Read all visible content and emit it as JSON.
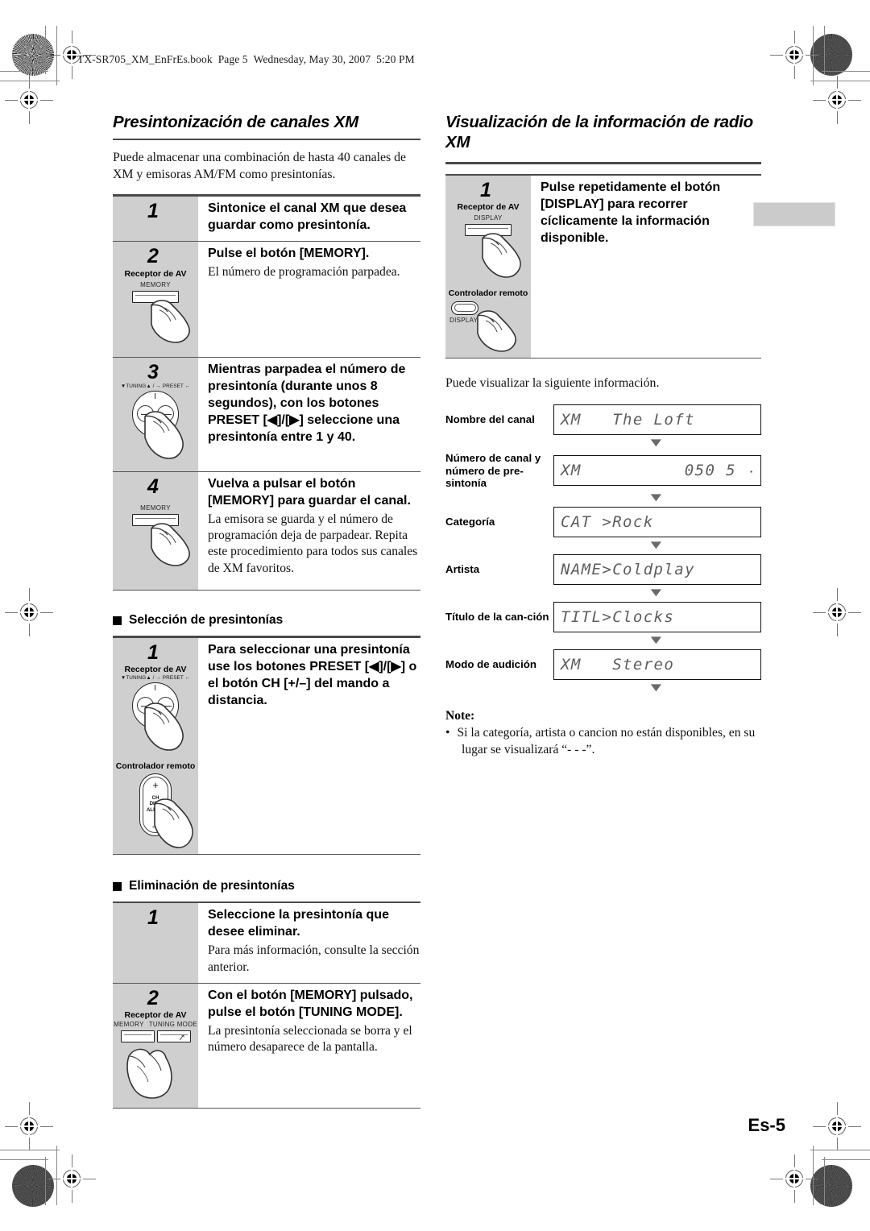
{
  "print_header": {
    "filename": "TX-SR705_XM_EnFrEs.book",
    "page": "Page 5",
    "weekday": "Wednesday, May 30, 2007",
    "time": "5:20 PM"
  },
  "page_number": "Es-5",
  "left_column": {
    "section_title": "Presintonización de canales XM",
    "intro": "Puede almacenar una combinación de hasta 40 canales de XM y emisoras AM/FM como presintonías.",
    "steps": [
      {
        "num": "1",
        "head": "Sintonice el canal XM que desea guardar como presintonía.",
        "sub": "",
        "device": null
      },
      {
        "num": "2",
        "head": "Pulse el botón [MEMORY].",
        "sub": "El número de programación parpadea.",
        "device": {
          "label": "Receptor de AV",
          "button": "MEMORY",
          "type": "push"
        }
      },
      {
        "num": "3",
        "head": "Mientras parpadea el número de presintonía (durante unos 8 segundos), con los botones PRESET [◀]/[▶] seleccione una presintonía entre 1 y 40.",
        "sub": "",
        "device": {
          "label": "",
          "button": "TUNING / PRESET",
          "type": "dial"
        }
      },
      {
        "num": "4",
        "head": "Vuelva a pulsar el botón [MEMORY] para guardar el canal.",
        "sub": "La emisora se guarda y el número de programación deja de parpadear. Repita este procedimiento para todos sus canales de XM favoritos.",
        "device": {
          "label": "",
          "button": "MEMORY",
          "type": "push"
        }
      }
    ],
    "subsection_select": {
      "title": "Selección de presintonías",
      "steps": [
        {
          "num": "1",
          "head": "Para seleccionar una presintonía use los botones PRESET [◀]/[▶] o el botón CH [+/–] del mando a distancia.",
          "sub": "",
          "device_receiver": {
            "label": "Receptor de AV",
            "button": "TUNING / PRESET",
            "type": "dial"
          },
          "device_remote": {
            "label": "Controlador remoto",
            "plus": "+",
            "minus": "–",
            "mid": "CH\nDISC\nALBUM",
            "type": "rocker"
          }
        }
      ]
    },
    "subsection_delete": {
      "title": "Eliminación de presintonías",
      "steps": [
        {
          "num": "1",
          "head": "Seleccione la presintonía que desee eliminar.",
          "sub": "Para más información, consulte la sección anterior.",
          "device": null
        },
        {
          "num": "2",
          "head": "Con el botón [MEMORY] pulsado, pulse el botón [TUNING MODE].",
          "sub": "La presintonía seleccionada se borra y el número desaparece de la pantalla.",
          "device": {
            "label": "Receptor de AV",
            "button_left": "MEMORY",
            "button_right": "TUNING MODE",
            "type": "twopush"
          }
        }
      ]
    }
  },
  "right_column": {
    "section_title": "Visualización de la información de radio XM",
    "steps": [
      {
        "num": "1",
        "head": "Pulse repetidamente el botón [DISPLAY] para recorrer cíclicamente la información disponible.",
        "sub": "",
        "device_receiver": {
          "label": "Receptor de AV",
          "button": "DISPLAY",
          "type": "push"
        },
        "device_remote": {
          "label": "Controlador remoto",
          "button": "DISPLAY",
          "type": "oval"
        }
      }
    ],
    "intro_after": "Puede visualizar la siguiente información.",
    "lcd_flow": [
      {
        "label": "Nombre del canal",
        "display_left": "XM   The Loft",
        "display_right": "",
        "dot": false
      },
      {
        "label": "Número de canal y número de pre-sintonía",
        "display_left": "XM",
        "display_right": "050   5",
        "dot": true
      },
      {
        "label": "Categoría",
        "display_left": "CAT >Rock",
        "display_right": "",
        "dot": false
      },
      {
        "label": "Artista",
        "display_left": "NAME>Coldplay",
        "display_right": "",
        "dot": false
      },
      {
        "label": "Título de la can-ción",
        "display_left": "TITL>Clocks",
        "display_right": "",
        "dot": false
      },
      {
        "label": "Modo de audición",
        "display_left": "XM   Stereo",
        "display_right": "",
        "dot": false
      }
    ],
    "note": {
      "title": "Note:",
      "items": [
        "Si la categoría, artista o cancion no están disponibles, en su lugar se visualizará “- - -”."
      ]
    }
  },
  "colors": {
    "step_panel": "#cfcfcf",
    "rule": "#4a4a4a",
    "lcd_text": "#3a3a3a",
    "tab_mark": "#cbcbcb"
  }
}
